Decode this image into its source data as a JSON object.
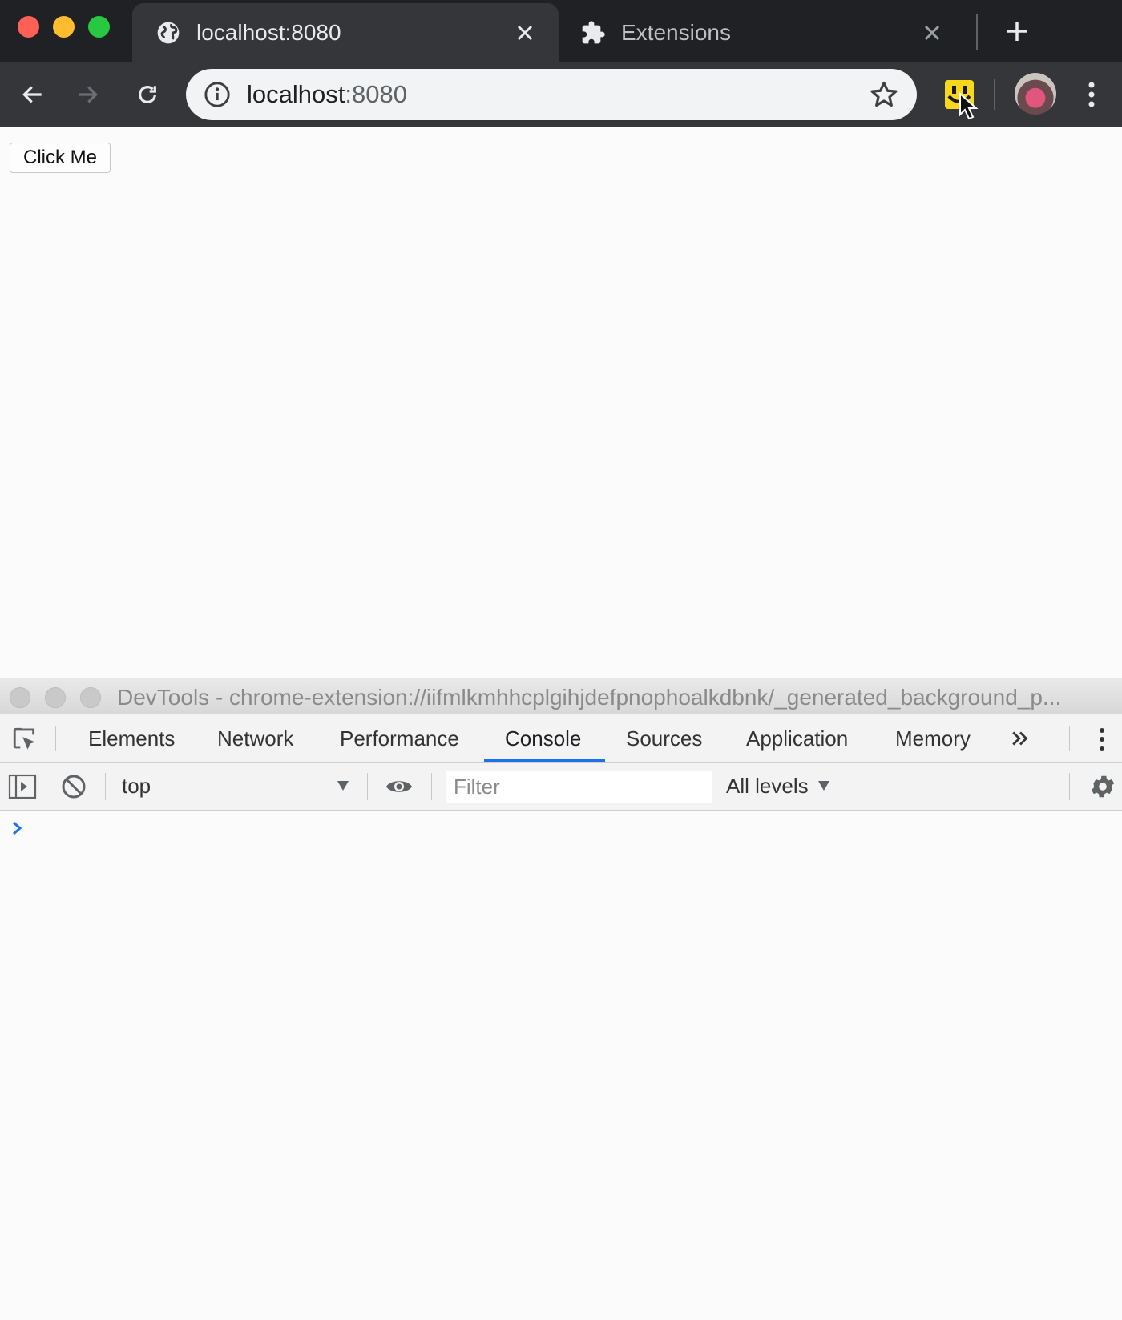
{
  "browser": {
    "tabs": [
      {
        "title": "localhost:8080",
        "icon": "globe-icon",
        "active": true
      },
      {
        "title": "Extensions",
        "icon": "puzzle-icon",
        "active": false
      }
    ],
    "address": {
      "host": "localhost",
      "port": ":8080"
    }
  },
  "page": {
    "button_label": "Click Me"
  },
  "devtools": {
    "window_title": "DevTools - chrome-extension://iifmlkmhhcplgihjdefpnophoalkdbnk/_generated_background_p...",
    "tabs": [
      "Elements",
      "Network",
      "Performance",
      "Console",
      "Sources",
      "Application",
      "Memory"
    ],
    "active_tab": "Console",
    "console_bar": {
      "context": "top",
      "filter_placeholder": "Filter",
      "levels": "All levels"
    }
  },
  "colors": {
    "accent": "#1a73e8",
    "extension_icon": "#f9d71c",
    "tab_strip": "#202124",
    "toolbar": "#35363a"
  }
}
